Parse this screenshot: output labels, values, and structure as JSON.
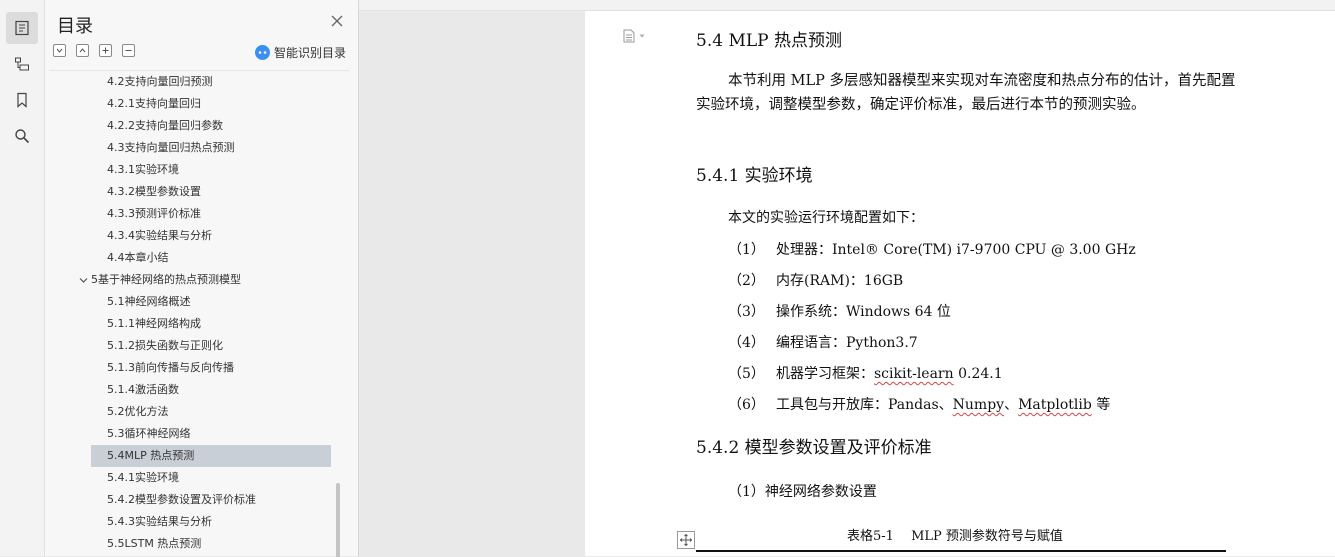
{
  "sidebar_panel": {
    "title": "目录",
    "smart_toc_label": "智能识别目录",
    "toc_items": [
      {
        "label": "4.2支持向量回归预测",
        "level": 2
      },
      {
        "label": "4.2.1支持向量回归",
        "level": 2
      },
      {
        "label": "4.2.2支持向量回归参数",
        "level": 2
      },
      {
        "label": "4.3支持向量回归热点预测",
        "level": 2
      },
      {
        "label": "4.3.1实验环境",
        "level": 2
      },
      {
        "label": "4.3.2模型参数设置",
        "level": 2
      },
      {
        "label": "4.3.3预测评价标准",
        "level": 2
      },
      {
        "label": "4.3.4实验结果与分析",
        "level": 2
      },
      {
        "label": "4.4本章小结",
        "level": 2
      },
      {
        "label": "5基于神经网络的热点预测模型",
        "level": 1,
        "expanded": true
      },
      {
        "label": "5.1神经网络概述",
        "level": 2
      },
      {
        "label": "5.1.1神经网络构成",
        "level": 2
      },
      {
        "label": "5.1.2损失函数与正则化",
        "level": 2
      },
      {
        "label": "5.1.3前向传播与反向传播",
        "level": 2
      },
      {
        "label": "5.1.4激活函数",
        "level": 2
      },
      {
        "label": "5.2优化方法",
        "level": 2
      },
      {
        "label": "5.3循环神经网络",
        "level": 2
      },
      {
        "label": "5.4MLP 热点预测",
        "level": 2,
        "selected": true
      },
      {
        "label": "5.4.1实验环境",
        "level": 2
      },
      {
        "label": "5.4.2模型参数设置及评价标准",
        "level": 2
      },
      {
        "label": "5.4.3实验结果与分析",
        "level": 2
      },
      {
        "label": "5.5LSTM 热点预测",
        "level": 2
      }
    ]
  },
  "document": {
    "h_54": "5.4 MLP 热点预测",
    "intro": "本节利用 MLP 多层感知器模型来实现对车流密度和热点分布的估计，首先配置实验环境，调整模型参数，确定评价标准，最后进行本节的预测实验。",
    "h_541": "5.4.1 实验环境",
    "env_intro": "本文的实验运行环境配置如下：",
    "env_items": [
      {
        "num": "（1）",
        "text": "处理器：Intel® Core(TM) i7-9700 CPU @ 3.00 GHz"
      },
      {
        "num": "（2）",
        "text": "内存(RAM)：16GB"
      },
      {
        "num": "（3）",
        "text": "操作系统：Windows 64 位"
      },
      {
        "num": "（4）",
        "text": "编程语言：Python3.7"
      },
      {
        "num": "（5）",
        "pre": "机器学习框架：",
        "squiggle": "scikit-learn",
        "post": " 0.24.1"
      },
      {
        "num": "（6）",
        "pre": "工具包与开放库：Pandas、",
        "squiggle": "Numpy",
        "mid": "、",
        "squiggle2": "Matplotlib",
        "post": " 等"
      }
    ],
    "h_542": "5.4.2 模型参数设置及评价标准",
    "sub_1": "（1）神经网络参数设置",
    "table_caption": "表格5-1　 MLP 预测参数符号与赋值"
  },
  "icons": {
    "rail": [
      "toc-icon",
      "toc-tree-icon",
      "bookmark-icon",
      "search-icon"
    ],
    "accent": "#3b8ff0",
    "selected_bg": "#c9cfd6",
    "spell_error": "#d64545"
  }
}
